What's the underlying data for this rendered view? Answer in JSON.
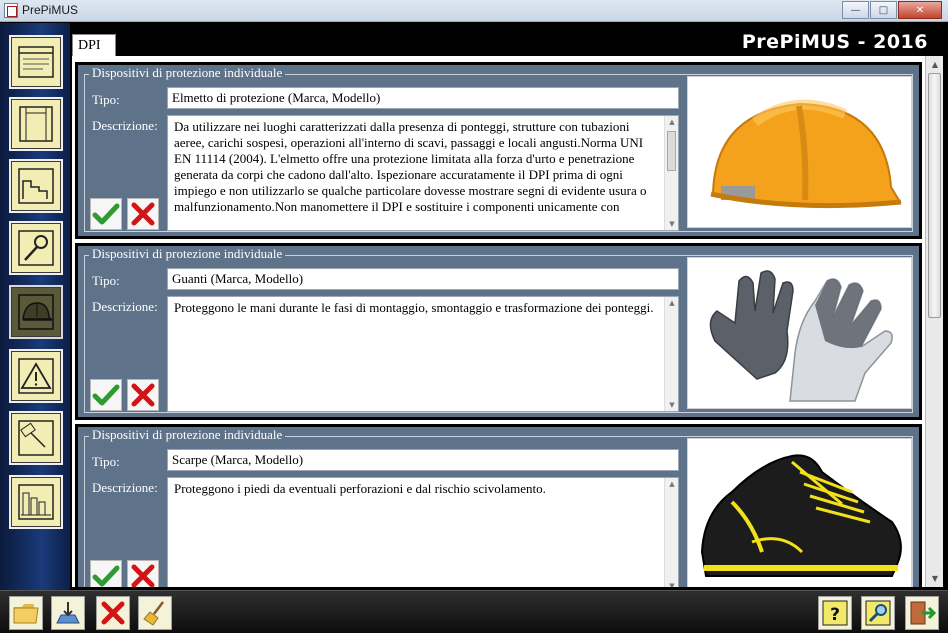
{
  "window": {
    "title": "PrePiMUS",
    "min": "—",
    "max": "□",
    "close": "✕"
  },
  "brand": "PrePiMUS - 2016",
  "tab": {
    "label": "DPI"
  },
  "sidebar": {
    "items": [
      {
        "name": "window-layout-icon",
        "active": false
      },
      {
        "name": "scaffold-frame-icon",
        "active": false
      },
      {
        "name": "buildings-icon",
        "active": false
      },
      {
        "name": "search-tool-icon",
        "active": false
      },
      {
        "name": "helmet-icon",
        "active": true
      },
      {
        "name": "warning-icon",
        "active": false
      },
      {
        "name": "edit-sheet-icon",
        "active": false
      },
      {
        "name": "plan-chart-icon",
        "active": false
      }
    ]
  },
  "labels": {
    "tipo": "Tipo:",
    "descrizione": "Descrizione:"
  },
  "dpi": [
    {
      "legend": "Dispositivi di protezione individuale",
      "tipo": "Elmetto di protezione (Marca, Modello)",
      "descrizione": "Da utilizzare nei luoghi caratterizzati dalla presenza di ponteggi, strutture con tubazioni aeree, carichi sospesi, operazioni all'interno di scavi, passaggi e locali angusti.Norma UNI EN 11114 (2004). L'elmetto offre una protezione limitata alla forza d'urto e penetrazione generata da corpi che cadono dall'alto. Ispezionare accuratamente il DPI prima di ogni impiego e non utilizzarlo se qualche particolare dovesse mostrare segni di evidente usura o malfunzionamento.Non manomettere il DPI e sostituire i componenti unicamente con",
      "image": "helmet-photo"
    },
    {
      "legend": "Dispositivi di protezione individuale",
      "tipo": "Guanti (Marca, Modello)",
      "descrizione": "Proteggono le mani durante le fasi di montaggio, smontaggio e trasformazione dei ponteggi.",
      "image": "gloves-photo"
    },
    {
      "legend": "Dispositivi di protezione individuale",
      "tipo": "Scarpe (Marca, Modello)",
      "descrizione": "Proteggono i piedi da eventuali perforazioni e dal rischio scivolamento.",
      "image": "shoes-photo"
    }
  ],
  "toolbar": {
    "left": [
      "folder-icon",
      "import-icon",
      "delete-icon",
      "broom-icon"
    ],
    "right": [
      "help-icon",
      "search-icon",
      "exit-icon"
    ],
    "help_label": "?"
  },
  "colors": {
    "panel": "#5e7289",
    "sidebar_button": "#f2eeb3",
    "brand": "#ffffff"
  }
}
